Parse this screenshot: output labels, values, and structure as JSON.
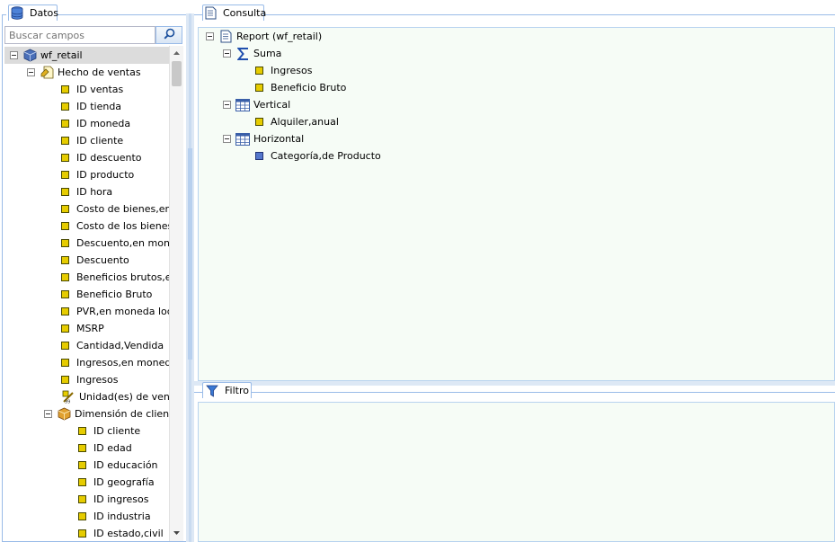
{
  "datos": {
    "title": "Datos",
    "search_placeholder": "Buscar campos",
    "tree": [
      {
        "label": "wf_retail",
        "kind": "cube",
        "level": 0,
        "toggle": true,
        "selected": true
      },
      {
        "label": "Hecho de ventas",
        "kind": "fact",
        "level": 1,
        "toggle": true
      },
      {
        "label": "ID ventas",
        "kind": "field",
        "level": 2
      },
      {
        "label": "ID tienda",
        "kind": "field",
        "level": 2
      },
      {
        "label": "ID moneda",
        "kind": "field",
        "level": 2
      },
      {
        "label": "ID cliente",
        "kind": "field",
        "level": 2
      },
      {
        "label": "ID descuento",
        "kind": "field",
        "level": 2
      },
      {
        "label": "ID producto",
        "kind": "field",
        "level": 2
      },
      {
        "label": "ID hora",
        "kind": "field",
        "level": 2
      },
      {
        "label": "Costo de bienes,en moneda local",
        "kind": "field",
        "level": 2
      },
      {
        "label": "Costo de los bienes",
        "kind": "field",
        "level": 2
      },
      {
        "label": "Descuento,en moneda local",
        "kind": "field",
        "level": 2
      },
      {
        "label": "Descuento",
        "kind": "field",
        "level": 2
      },
      {
        "label": "Beneficios brutos,en moneda local",
        "kind": "field",
        "level": 2
      },
      {
        "label": "Beneficio Bruto",
        "kind": "field",
        "level": 2
      },
      {
        "label": "PVR,en moneda local",
        "kind": "field",
        "level": 2
      },
      {
        "label": "MSRP",
        "kind": "field",
        "level": 2
      },
      {
        "label": "Cantidad,Vendida",
        "kind": "field",
        "level": 2
      },
      {
        "label": "Ingresos,en moneda local",
        "kind": "field",
        "level": 2
      },
      {
        "label": "Ingresos",
        "kind": "field",
        "level": 2
      },
      {
        "label": "Unidad(es) de venta",
        "kind": "measure",
        "level": 2
      },
      {
        "label": "Dimensión de cliente",
        "kind": "dimension",
        "level": 2,
        "toggle": true
      },
      {
        "label": "ID cliente",
        "kind": "field",
        "level": 3
      },
      {
        "label": "ID edad",
        "kind": "field",
        "level": 3
      },
      {
        "label": "ID educación",
        "kind": "field",
        "level": 3
      },
      {
        "label": "ID geografía",
        "kind": "field",
        "level": 3
      },
      {
        "label": "ID ingresos",
        "kind": "field",
        "level": 3
      },
      {
        "label": "ID industria",
        "kind": "field",
        "level": 3
      },
      {
        "label": "ID estado,civil",
        "kind": "field",
        "level": 3
      }
    ]
  },
  "consulta": {
    "title": "Consulta",
    "tree": [
      {
        "label": "Report (wf_retail)",
        "kind": "report",
        "level": 0,
        "toggle": true
      },
      {
        "label": "Suma",
        "kind": "sigma",
        "level": 1,
        "toggle": true
      },
      {
        "label": "Ingresos",
        "kind": "field",
        "level": 2
      },
      {
        "label": "Beneficio Bruto",
        "kind": "field",
        "level": 2
      },
      {
        "label": "Vertical",
        "kind": "grid",
        "level": 1,
        "toggle": true
      },
      {
        "label": "Alquiler,anual",
        "kind": "field",
        "level": 2
      },
      {
        "label": "Horizontal",
        "kind": "grid",
        "level": 1,
        "toggle": true
      },
      {
        "label": "Categoría,de Producto",
        "kind": "field-blue",
        "level": 2
      }
    ]
  },
  "filtro": {
    "title": "Filtro"
  },
  "colors": {
    "border": "#99bbe8",
    "pane_bg": "#f6fcf6",
    "selection": "#dcdcdc",
    "field_icon": "#e6cc00"
  }
}
